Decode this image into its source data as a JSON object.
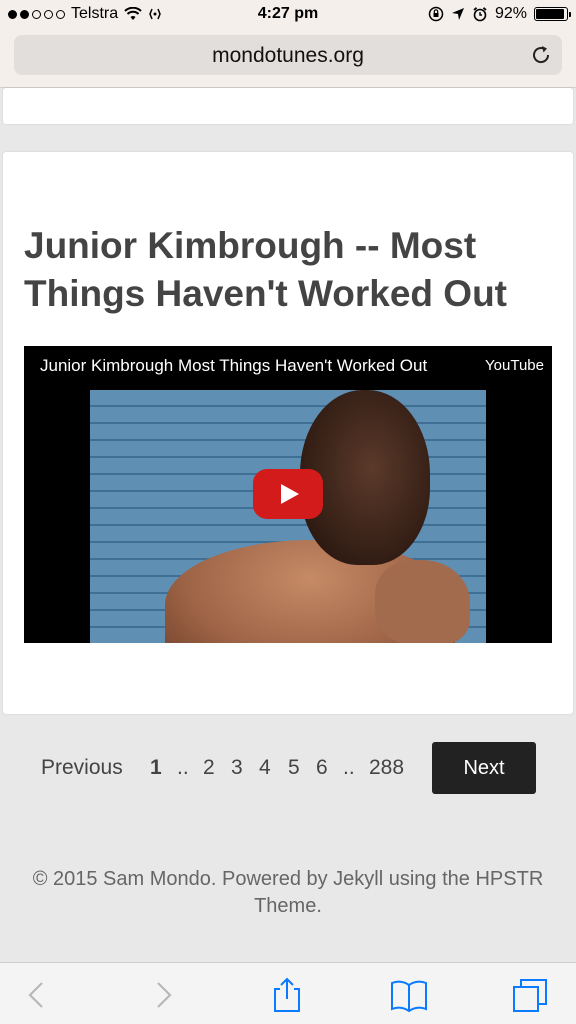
{
  "status_bar": {
    "carrier": "Telstra",
    "time": "4:27 pm",
    "battery_percent": "92%",
    "battery_level": 0.92
  },
  "browser": {
    "url": "mondotunes.org"
  },
  "post": {
    "title": "Junior Kimbrough -- Most Things Haven't Worked Out",
    "video": {
      "title": "Junior Kimbrough Most Things Haven't Worked Out",
      "brand": "YouTube"
    }
  },
  "pagination": {
    "previous_label": "Previous",
    "pages": [
      "1",
      "..",
      "2",
      "3",
      "4",
      "5",
      "6",
      "..",
      "288"
    ],
    "current_page": "1",
    "next_label": "Next"
  },
  "footer": {
    "text": "© 2015 Sam Mondo. Powered by Jekyll using the HPSTR Theme."
  },
  "colors": {
    "accent_blue": "#0a7aff",
    "next_button_bg": "#222222",
    "youtube_red": "#d41b1b"
  },
  "icons": [
    "wifi-icon",
    "location-arrow-icon",
    "rotation-lock-icon",
    "alarm-icon",
    "battery-icon",
    "reload-icon",
    "back-icon",
    "forward-icon",
    "share-icon",
    "bookmarks-icon",
    "tabs-icon",
    "play-icon"
  ]
}
